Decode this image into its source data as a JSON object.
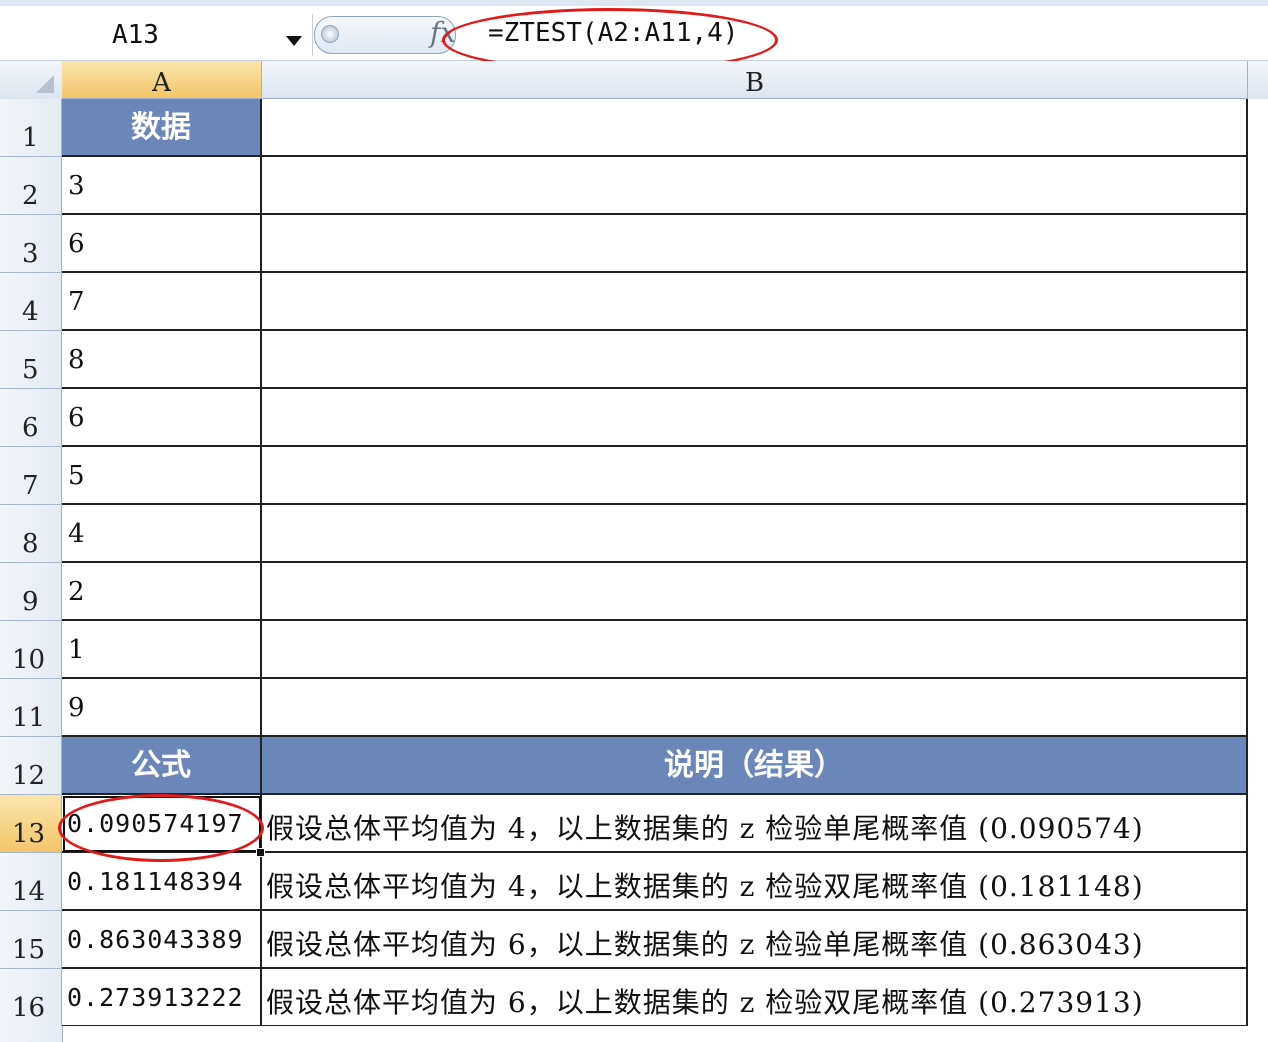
{
  "formula_bar": {
    "name_box": "A13",
    "fx_label": "fx",
    "formula": "=ZTEST(A2:A11,4)"
  },
  "columns": [
    "A",
    "B"
  ],
  "rows": [
    "1",
    "2",
    "3",
    "4",
    "5",
    "6",
    "7",
    "8",
    "9",
    "10",
    "11",
    "12",
    "13",
    "14",
    "15",
    "16"
  ],
  "sheet": {
    "data_header": "数据",
    "data_values": [
      "3",
      "6",
      "7",
      "8",
      "6",
      "5",
      "4",
      "2",
      "1",
      "9"
    ],
    "formula_header": "公式",
    "desc_header": "说明（结果）",
    "results": [
      {
        "value": "0.090574197",
        "desc": "假设总体平均值为 4，以上数据集的 z 检验单尾概率值 (0.090574)"
      },
      {
        "value": "0.181148394",
        "desc": "假设总体平均值为 4，以上数据集的 z 检验双尾概率值 (0.181148)"
      },
      {
        "value": "0.863043389",
        "desc": "假设总体平均值为 6，以上数据集的 z 检验单尾概率值 (0.863043)"
      },
      {
        "value": "0.273913222",
        "desc": "假设总体平均值为 6，以上数据集的 z 检验双尾概率值 (0.273913)"
      }
    ]
  },
  "colors": {
    "header_fill": "#6b86b9",
    "annotation": "#e01b1b",
    "active_header": "#f4c56a"
  }
}
